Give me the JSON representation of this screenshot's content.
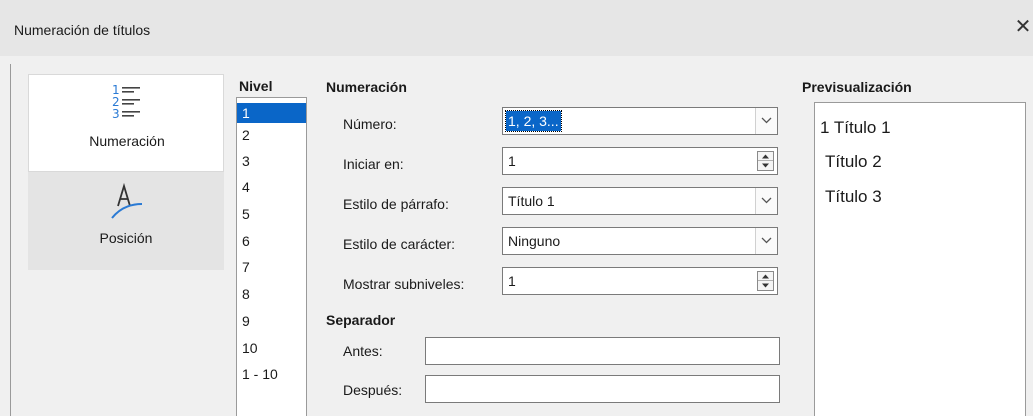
{
  "window": {
    "title": "Numeración de títulos"
  },
  "sidebar": {
    "tabs": [
      {
        "label": "Numeración",
        "icon": "numbered-list-icon",
        "active": true
      },
      {
        "label": "Posición",
        "icon": "position-pen-icon",
        "active": false
      }
    ]
  },
  "level": {
    "header": "Nivel",
    "items": [
      "1",
      "2",
      "3",
      "4",
      "5",
      "6",
      "7",
      "8",
      "9",
      "10",
      "1 - 10"
    ],
    "selected": "1"
  },
  "numbering": {
    "header": "Numeración",
    "number_label": "Número:",
    "number_value": "1, 2, 3...",
    "start_label": "Iniciar en:",
    "start_value": "1",
    "para_style_label": "Estilo de párrafo:",
    "para_style_value": "Título 1",
    "char_style_label": "Estilo de carácter:",
    "char_style_value": "Ninguno",
    "sublevels_label": "Mostrar subniveles:",
    "sublevels_value": "1"
  },
  "separator": {
    "header": "Separador",
    "before_label": "Antes:",
    "before_value": "",
    "after_label": "Después:",
    "after_value": ""
  },
  "preview": {
    "header": "Previsualización",
    "lines": [
      "1 Título 1",
      "Título 2",
      "Título 3"
    ]
  },
  "colors": {
    "selection": "#0a66c8",
    "icon_blue": "#2a7ad4"
  }
}
